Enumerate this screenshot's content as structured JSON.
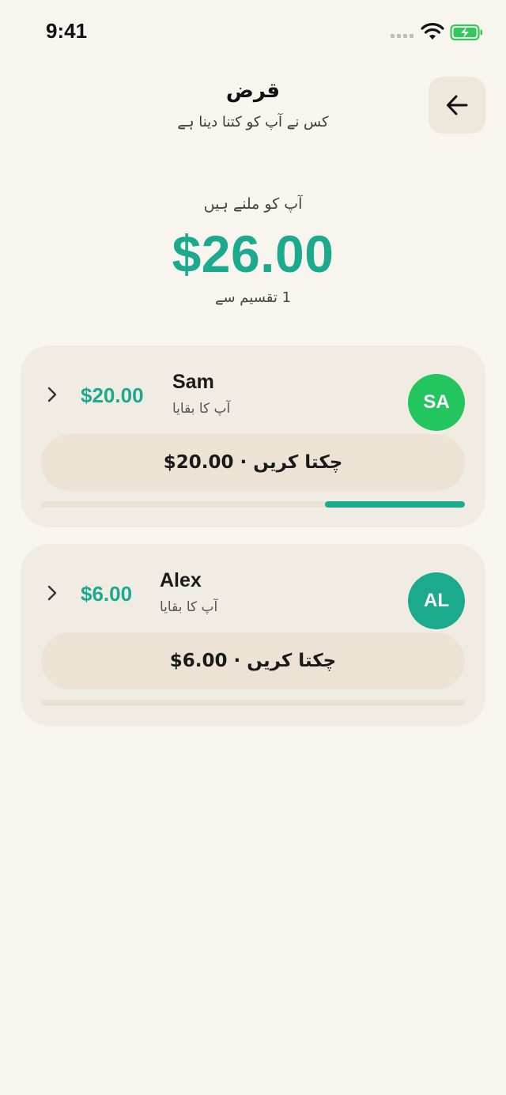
{
  "status_bar": {
    "time": "9:41"
  },
  "header": {
    "title": "قرض",
    "subtitle": "کس نے آپ کو کتنا دینا ہے",
    "back_icon": "arrow-left-icon"
  },
  "summary": {
    "label": "آپ کو  ملنے  ہیں",
    "total": "$26.00",
    "splits": "1 تقسیم سے"
  },
  "colors": {
    "accent": "#1BAA8E",
    "background": "#F8F5EF",
    "card": "#F1ECE3",
    "avatar_sam": "#22C55E",
    "avatar_alex": "#1BAA8E"
  },
  "debtors": [
    {
      "initials": "SA",
      "name": "Sam",
      "subtitle": "آپ کا بقایا",
      "amount": "$20.00",
      "settle_label": "چکتا کریں · 20.00$",
      "progress": 0.33
    },
    {
      "initials": "AL",
      "name": "Alex",
      "subtitle": "آپ کا بقایا",
      "amount": "$6.00",
      "settle_label": "چکتا کریں · 6.00$",
      "progress": 0
    }
  ]
}
